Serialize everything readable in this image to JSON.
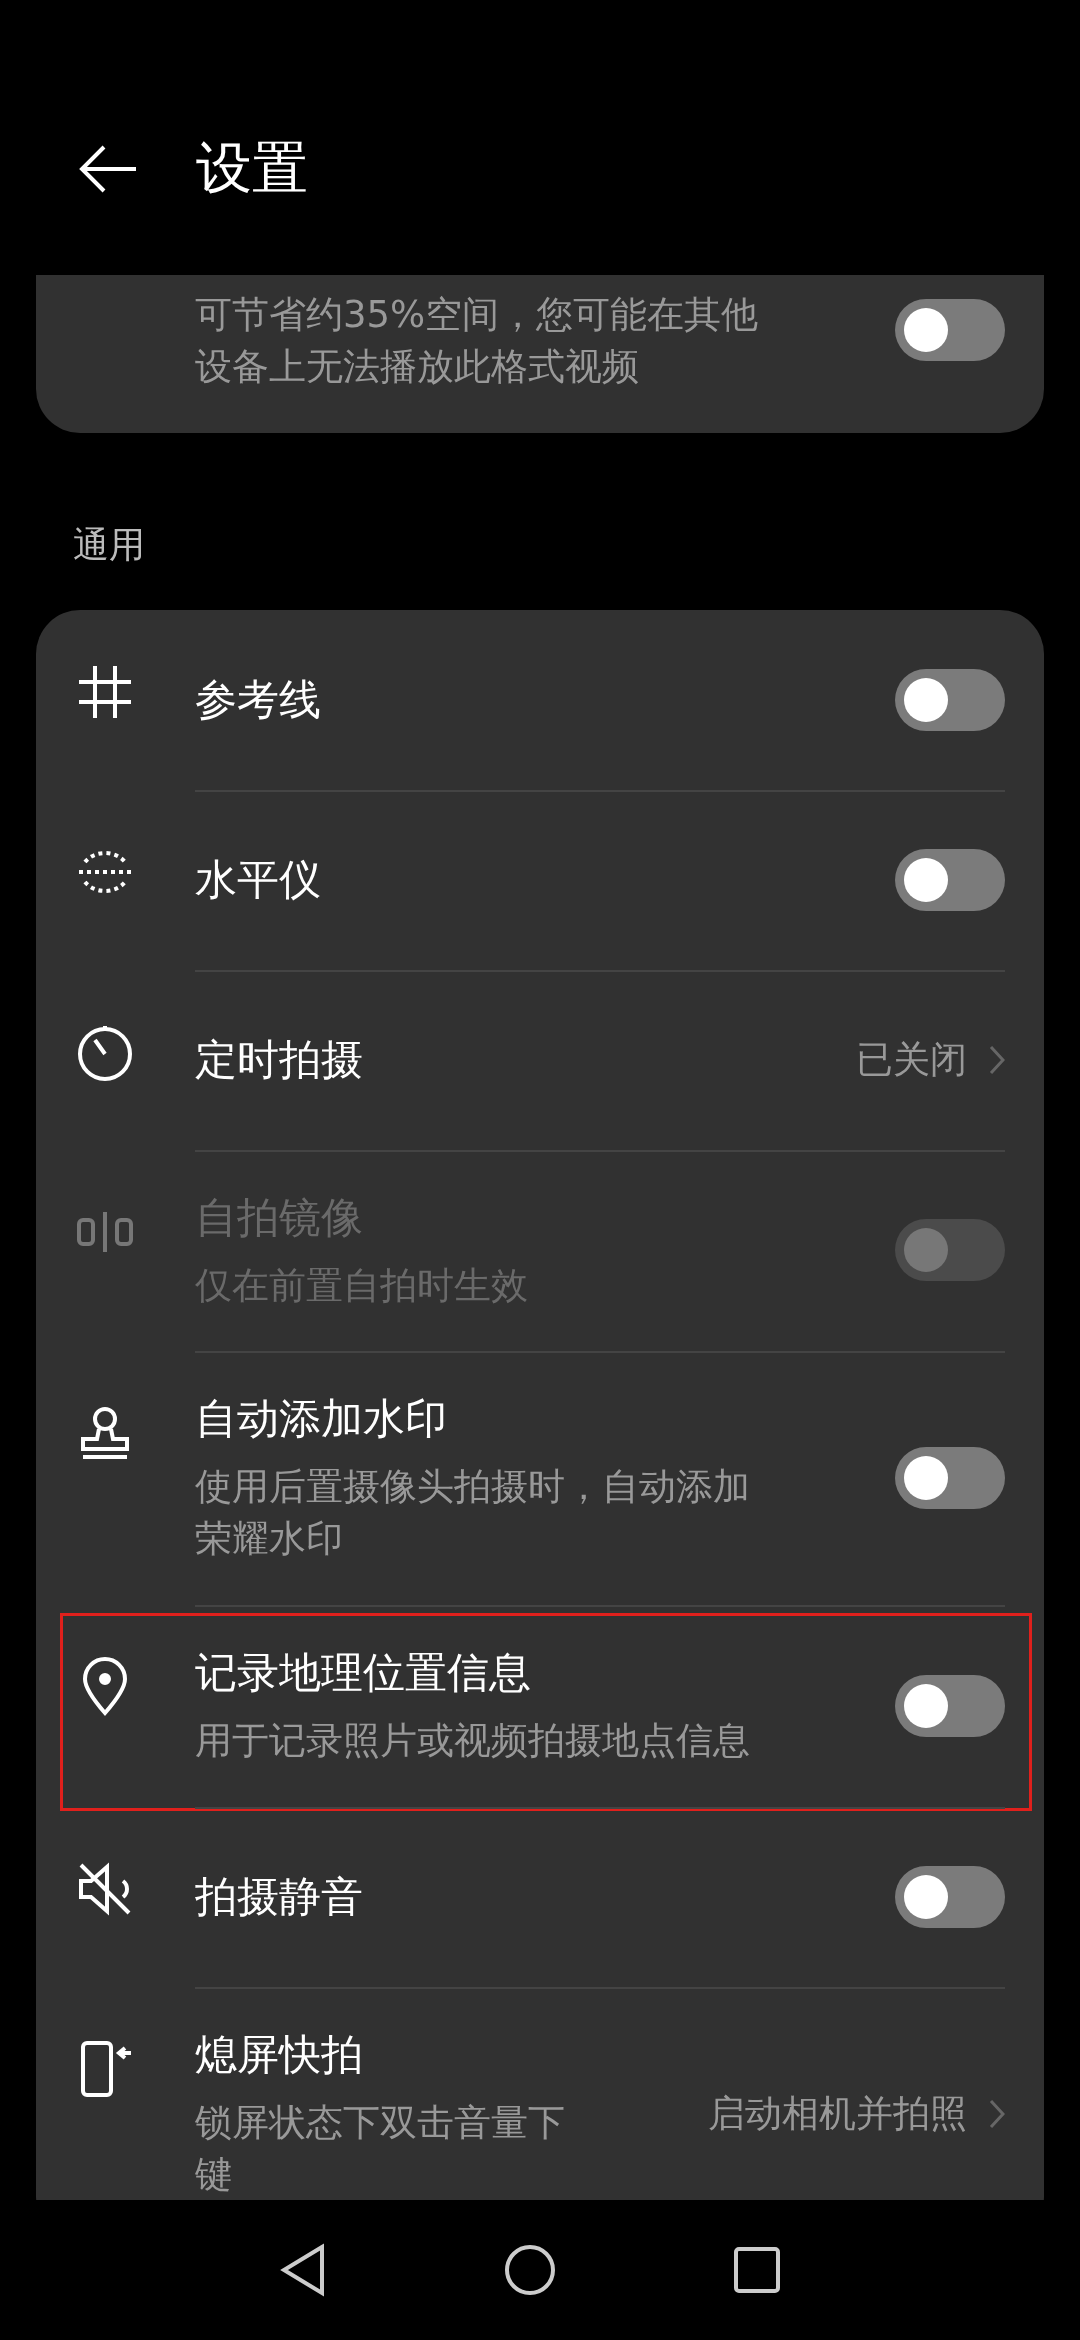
{
  "header": {
    "title": "设置"
  },
  "top_card": {
    "subtitle": "可节省约35%空间，您可能在其他设备上无法播放此格式视频",
    "on": false
  },
  "section": {
    "title": "通用"
  },
  "items": [
    {
      "kind": "toggle",
      "title": "参考线",
      "on": false,
      "disabled": false,
      "highlighted": false
    },
    {
      "kind": "toggle",
      "title": "水平仪",
      "on": false,
      "disabled": false,
      "highlighted": false
    },
    {
      "kind": "value",
      "title": "定时拍摄",
      "value": "已关闭",
      "disabled": false,
      "highlighted": false
    },
    {
      "kind": "toggle",
      "title": "自拍镜像",
      "subtitle": "仅在前置自拍时生效",
      "on": false,
      "disabled": true,
      "highlighted": false
    },
    {
      "kind": "toggle",
      "title": "自动添加水印",
      "subtitle": "使用后置摄像头拍摄时，自动添加荣耀水印",
      "on": false,
      "disabled": false,
      "highlighted": false
    },
    {
      "kind": "toggle",
      "title": "记录地理位置信息",
      "subtitle": "用于记录照片或视频拍摄地点信息",
      "on": false,
      "disabled": false,
      "highlighted": true
    },
    {
      "kind": "toggle",
      "title": "拍摄静音",
      "on": false,
      "disabled": false,
      "highlighted": false
    },
    {
      "kind": "value",
      "title": "熄屏快拍",
      "subtitle": "锁屏状态下双击音量下键",
      "value": "启动相机并拍照",
      "disabled": false,
      "highlighted": false
    }
  ]
}
